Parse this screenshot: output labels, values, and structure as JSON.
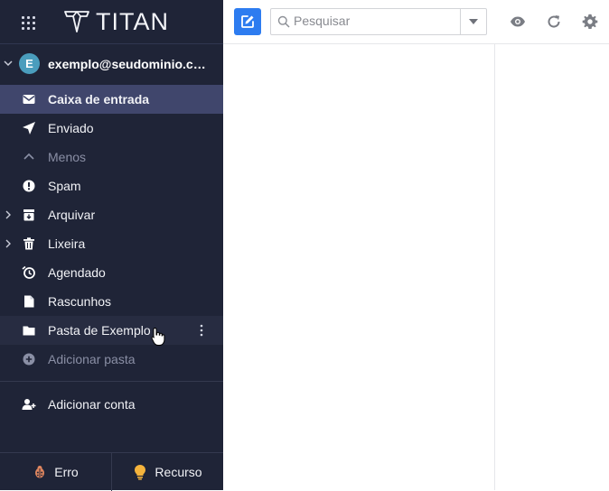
{
  "brand": {
    "name": "TITAN",
    "grid_icon": "apps-grid-icon",
    "logo_icon": "titan-logo-icon"
  },
  "account": {
    "avatar_letter": "E",
    "email": "exemplo@seudominio.com",
    "avatar_color": "#4a9dbd"
  },
  "folders": [
    {
      "label": "Caixa de entrada",
      "icon": "envelope-icon"
    },
    {
      "label": "Enviado",
      "icon": "paper-plane-icon"
    },
    {
      "label": "Menos",
      "icon": "chevron-up-icon"
    },
    {
      "label": "Spam",
      "icon": "alert-circle-icon"
    },
    {
      "label": "Arquivar",
      "icon": "archive-icon"
    },
    {
      "label": "Lixeira",
      "icon": "trash-icon"
    },
    {
      "label": "Agendado",
      "icon": "clock-icon"
    },
    {
      "label": "Rascunhos",
      "icon": "draft-icon"
    },
    {
      "label": "Pasta de Exemplo",
      "icon": "folder-icon"
    },
    {
      "label": "Adicionar pasta",
      "icon": "plus-circle-icon"
    }
  ],
  "add_account": {
    "label": "Adicionar conta",
    "icon": "add-user-icon"
  },
  "footer": {
    "bug_label": "Erro",
    "feature_label": "Recurso"
  },
  "toolbar": {
    "search_placeholder": "Pesquisar"
  },
  "colors": {
    "sidebar_bg": "#1f2437",
    "active_bg": "#40466c",
    "accent": "#2d7cf0"
  }
}
